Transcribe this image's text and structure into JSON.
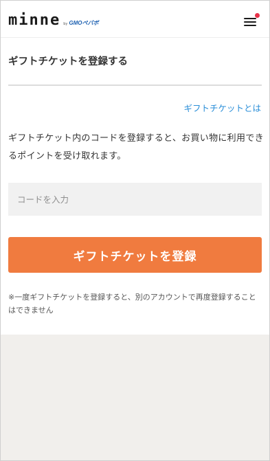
{
  "header": {
    "logo_text": "minne",
    "logo_by": "by",
    "logo_partner": "GMOペパボ"
  },
  "page": {
    "title": "ギフトチケットを登録する",
    "about_link": "ギフトチケットとは",
    "description": "ギフトチケット内のコードを登録すると、お買い物に利用できるポイントを受け取れます。",
    "code_input": {
      "value": "",
      "placeholder": "コードを入力"
    },
    "submit_label": "ギフトチケットを登録",
    "note": "※一度ギフトチケットを登録すると、別のアカウントで再度登録することはできません"
  },
  "colors": {
    "accent": "#f07b3f",
    "link": "#2a8ed8",
    "notification_dot": "#e8334a",
    "footer_background": "#f1efec"
  },
  "icons": {
    "menu": "hamburger-menu-icon",
    "notification": "notification-dot-icon"
  }
}
